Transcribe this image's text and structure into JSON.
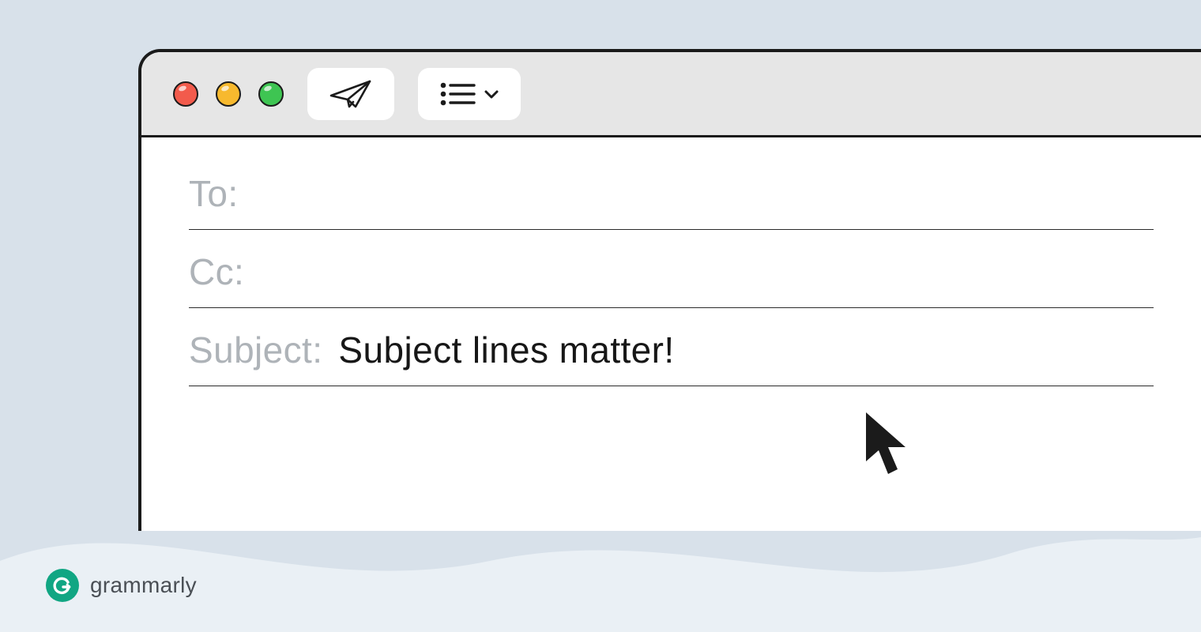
{
  "window": {
    "traffic_lights": [
      "close",
      "minimize",
      "zoom"
    ],
    "toolbar": {
      "send_icon": "paper-plane-icon",
      "format_icon": "list-icon",
      "format_dropdown_icon": "chevron-down-icon"
    }
  },
  "compose": {
    "to_label": "To:",
    "to_value": "",
    "cc_label": "Cc:",
    "cc_value": "",
    "subject_label": "Subject:",
    "subject_value": "Subject lines matter!"
  },
  "brand": {
    "name": "grammarly",
    "badge_letter": "G"
  },
  "colors": {
    "background": "#d8e1ea",
    "window_border": "#1b1b1b",
    "titlebar": "#e6e6e6",
    "label_grey": "#aeb3b8",
    "text_black": "#171717",
    "brand_green": "#11a683",
    "traffic_red": "#f25b4c",
    "traffic_yellow": "#f7b92e",
    "traffic_green": "#3ec552"
  }
}
